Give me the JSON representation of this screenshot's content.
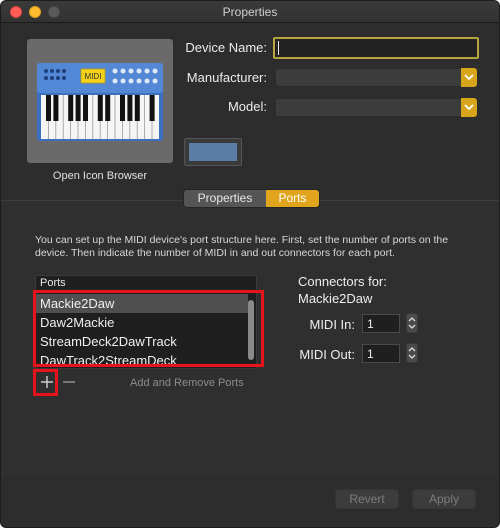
{
  "window": {
    "title": "Properties"
  },
  "device": {
    "icon_name": "midi-keyboard-synth-icon",
    "icon_badge": "MIDI",
    "open_icon_browser_label": "Open Icon Browser",
    "name_label": "Device Name:",
    "name_value": "",
    "manufacturer_label": "Manufacturer:",
    "manufacturer_value": "",
    "model_label": "Model:",
    "model_value": "",
    "color": "#5b7da5"
  },
  "tabs": [
    {
      "label": "Properties",
      "selected": false
    },
    {
      "label": "Ports",
      "selected": true
    }
  ],
  "ports_tab": {
    "description": "You can set up the MIDI device's port structure here. First, set the number of ports on the device. Then indicate the number of MIDI in and out connectors for each port.",
    "table_header": "Ports",
    "ports": [
      "Mackie2Daw",
      "Daw2Mackie",
      "StreamDeck2DawTrack",
      "DawTrack2StreamDeck"
    ],
    "selected_port": "Mackie2Daw",
    "add_icon": "plus-icon",
    "remove_icon": "minus-icon",
    "add_remove_label": "Add and Remove Ports",
    "connectors_title": "Connectors for:",
    "connectors_port": "Mackie2Daw",
    "midi_in_label": "MIDI In:",
    "midi_in_value": "1",
    "midi_out_label": "MIDI Out:",
    "midi_out_value": "1"
  },
  "footer": {
    "revert_label": "Revert",
    "apply_label": "Apply"
  },
  "colors": {
    "accent": "#e0a51c",
    "highlight_annotation": "#e8121a",
    "focus_ring": "#b8a43a"
  }
}
